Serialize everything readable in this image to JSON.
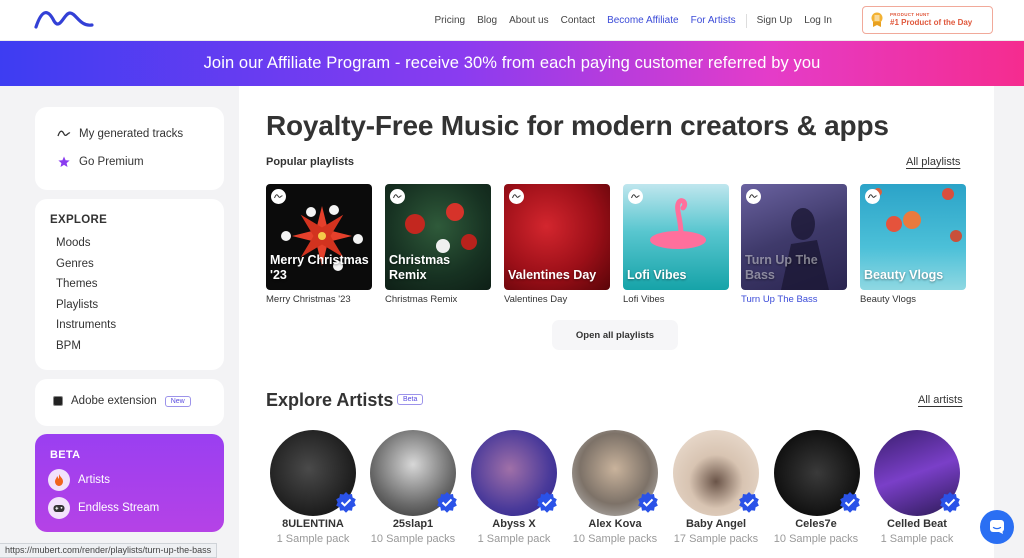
{
  "header": {
    "nav": [
      {
        "label": "Pricing",
        "accent": false
      },
      {
        "label": "Blog",
        "accent": false
      },
      {
        "label": "About us",
        "accent": false
      },
      {
        "label": "Contact",
        "accent": false
      },
      {
        "label": "Become Affiliate",
        "accent": true
      },
      {
        "label": "For Artists",
        "accent": true
      },
      {
        "label": "Sign Up",
        "accent": false
      },
      {
        "label": "Log In",
        "accent": false
      }
    ],
    "product_hunt": {
      "small": "PRODUCT HUNT",
      "big": "#1 Product of the Day"
    }
  },
  "banner": {
    "text": "Join our Affiliate Program - receive 30% from each paying customer referred by you"
  },
  "sidebar": {
    "top_items": [
      {
        "label": "My generated tracks",
        "icon": "wave-icon"
      },
      {
        "label": "Go Premium",
        "icon": "star-icon"
      }
    ],
    "explore": {
      "heading": "EXPLORE",
      "items": [
        "Moods",
        "Genres",
        "Themes",
        "Playlists",
        "Instruments",
        "BPM"
      ]
    },
    "adobe": {
      "label": "Adobe extension",
      "badge": "New"
    },
    "beta": {
      "heading": "BETA",
      "items": [
        {
          "label": "Artists",
          "icon": "fire-icon"
        },
        {
          "label": "Endless Stream",
          "icon": "gamepad-icon"
        }
      ]
    }
  },
  "main": {
    "title": "Royalty-Free Music for modern creators & apps",
    "playlists_heading": "Popular playlists",
    "all_playlists": "All playlists",
    "playlists": [
      {
        "overlay": "Merry Christmas '23",
        "caption": "Merry Christmas '23",
        "active": false
      },
      {
        "overlay": "Christmas Remix",
        "caption": "Christmas Remix",
        "active": false
      },
      {
        "overlay": "Valentines Day",
        "caption": "Valentines Day",
        "active": false
      },
      {
        "overlay": "Lofi Vibes",
        "caption": "Lofi Vibes",
        "active": false
      },
      {
        "overlay": "Turn Up The Bass",
        "caption": "Turn Up The Bass",
        "active": true
      },
      {
        "overlay": "Beauty Vlogs",
        "caption": "Beauty Vlogs",
        "active": false
      }
    ],
    "open_all": "Open all playlists",
    "artists_heading": "Explore Artists",
    "beta_tag": "Beta",
    "all_artists": "All artists",
    "artists": [
      {
        "name": "8ULENTINA",
        "packs": "1 Sample pack"
      },
      {
        "name": "25slap1",
        "packs": "10 Sample packs"
      },
      {
        "name": "Abyss X",
        "packs": "1 Sample pack"
      },
      {
        "name": "Alex Kova",
        "packs": "10 Sample packs"
      },
      {
        "name": "Baby Angel",
        "packs": "17 Sample packs"
      },
      {
        "name": "Celes7e",
        "packs": "10 Sample packs"
      },
      {
        "name": "Celled Beat",
        "packs": "1 Sample pack"
      }
    ]
  },
  "status_bar": {
    "url": "https://mubert.com/render/playlists/turn-up-the-bass"
  },
  "colors": {
    "accent": "#3b4bd8",
    "premium": "#8a3cf0",
    "chat": "#2a6ff3"
  }
}
